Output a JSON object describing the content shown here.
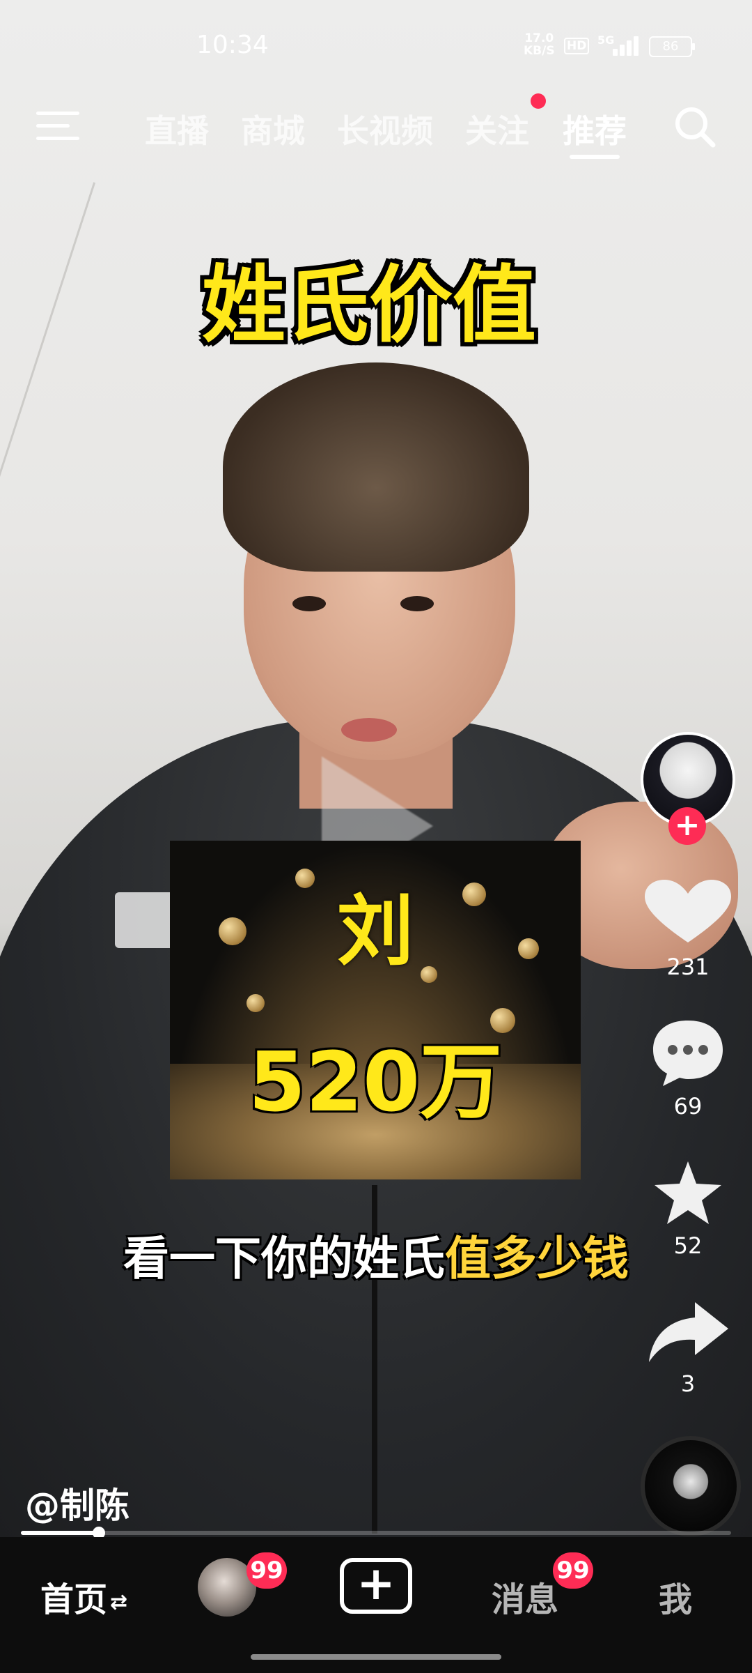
{
  "status_bar": {
    "time": "10:34",
    "net_speed_value": "17.0",
    "net_speed_unit": "KB/S",
    "hd_label": "HD",
    "network_type": "5G",
    "battery": "86"
  },
  "top_nav": {
    "tabs": [
      {
        "label": "直播",
        "active": false
      },
      {
        "label": "商城",
        "active": false
      },
      {
        "label": "长视频",
        "active": false
      },
      {
        "label": "关注",
        "active": false
      },
      {
        "label": "推荐",
        "active": true
      }
    ],
    "menu_icon": "menu-icon",
    "search_icon": "search-icon",
    "follow_notification_color": "#fe2c55"
  },
  "video": {
    "title": "姓氏价值",
    "surname": "刘",
    "amount": "520万",
    "caption_white": "看一下你的姓氏",
    "caption_yellow": "值多少钱",
    "author": "@制陈",
    "progress": 0.11
  },
  "rail": {
    "follow_symbol": "+",
    "likes": "231",
    "comments": "69",
    "favorites": "52",
    "shares": "3",
    "icons": [
      "heart-icon",
      "comment-icon",
      "star-icon",
      "share-icon"
    ]
  },
  "bottom_nav": {
    "home_label": "首页",
    "home_swap_symbol": "⇄",
    "friends_badge": "99",
    "add_symbol": "+",
    "messages_label": "消息",
    "messages_badge": "99",
    "me_label": "我"
  },
  "colors": {
    "accent_red": "#fe2c55",
    "title_yellow": "#ffe81a",
    "caption_yellow": "#ffd43b"
  }
}
